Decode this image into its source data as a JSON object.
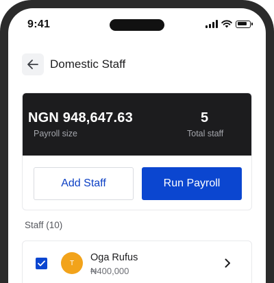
{
  "status_bar": {
    "time": "9:41",
    "icons": [
      "cellular-signal-icon",
      "wifi-icon",
      "battery-icon"
    ]
  },
  "header": {
    "back_icon": "arrow-left-icon",
    "title": "Domestic Staff"
  },
  "summary": {
    "payroll_amount": "NGN 948,647.63",
    "payroll_label": "Payroll size",
    "total_staff": "5",
    "total_staff_label": "Total staff"
  },
  "actions": {
    "add_staff_label": "Add Staff",
    "run_payroll_label": "Run Payroll"
  },
  "staff_section": {
    "title": "Staff (10)",
    "items": [
      {
        "checked": true,
        "avatar_initial": "T",
        "name": "Oga Rufus",
        "salary": "₦400,000"
      }
    ]
  },
  "colors": {
    "primary": "#0b46d0",
    "dark_card": "#1c1c1e",
    "avatar": "#f2a31b"
  }
}
